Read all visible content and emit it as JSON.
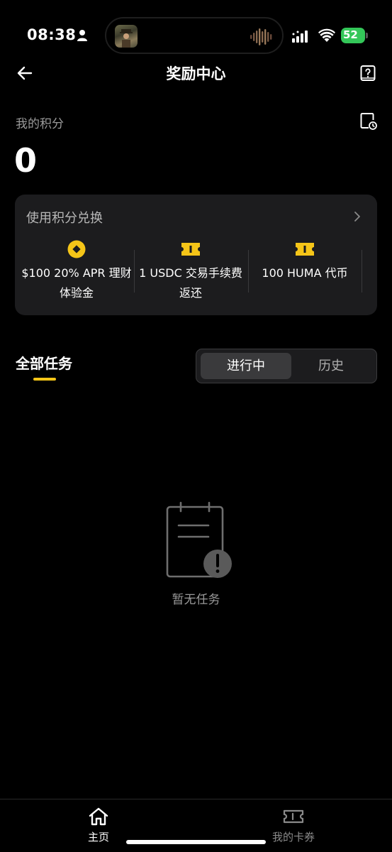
{
  "status_bar": {
    "time": "08:38",
    "battery": "52"
  },
  "header": {
    "title": "奖励中心"
  },
  "points": {
    "label": "我的积分",
    "value": "0"
  },
  "redeem": {
    "title": "使用积分兑换",
    "items": [
      {
        "icon": "coin-icon",
        "label": "$100 20% APR 理财体验金"
      },
      {
        "icon": "ticket-icon",
        "label": "1 USDC 交易手续费返还"
      },
      {
        "icon": "ticket-icon",
        "label": "100 HUMA 代币"
      }
    ]
  },
  "tasks": {
    "tab_label": "全部任务",
    "segments": [
      "进行中",
      "历史"
    ],
    "active_segment": "进行中",
    "empty_text": "暂无任务"
  },
  "bottom_nav": {
    "items": [
      {
        "label": "主页",
        "icon": "home-icon",
        "active": true
      },
      {
        "label": "我的卡券",
        "icon": "coupon-icon",
        "active": false
      }
    ]
  },
  "colors": {
    "background": "#000000",
    "card": "#1c1c1e",
    "accent": "#f5c518",
    "battery": "#34c759"
  }
}
